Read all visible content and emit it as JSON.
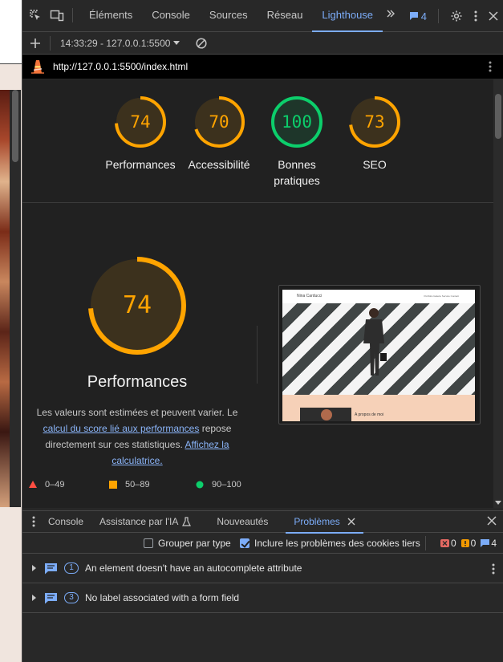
{
  "devtools": {
    "tabs": [
      "Éléments",
      "Console",
      "Sources",
      "Réseau",
      "Lighthouse"
    ],
    "active_tab": "Lighthouse",
    "issues_count": "4"
  },
  "toolbar": {
    "run_label": "14:33:29 - 127.0.0.1:5500"
  },
  "report": {
    "url": "http://127.0.0.1:5500/index.html",
    "scores": [
      {
        "label": "Performances",
        "value": 74,
        "color": "#ffa400"
      },
      {
        "label": "Accessibilité",
        "value": 70,
        "color": "#ffa400"
      },
      {
        "label": "Bonnes pratiques",
        "value": 100,
        "color": "#0cce6b"
      },
      {
        "label": "SEO",
        "value": 73,
        "color": "#ffa400"
      }
    ],
    "main_category": {
      "title": "Performances",
      "value": 74,
      "desc_part1": "Les valeurs sont estimées et peuvent varier. Le",
      "desc_link1": "calcul du score lié aux performances",
      "desc_part2": "repose directement sur ces statistiques.",
      "desc_link2": "Affichez la calculatrice."
    },
    "legend": [
      {
        "range": "0–49",
        "color": "#ff4e42"
      },
      {
        "range": "50–89",
        "color": "#ffa400"
      },
      {
        "range": "90–100",
        "color": "#0cce6b"
      }
    ],
    "screenshot": {
      "brand": "Nina Carducci",
      "nav": "Portfolio   Galerie   Service   Contact",
      "section": "A propos de moi"
    }
  },
  "drawer": {
    "tabs": [
      "Console",
      "Assistance par l'IA",
      "Nouveautés",
      "Problèmes"
    ],
    "active_tab": "Problèmes",
    "group_by_type": "Grouper par type",
    "include_cookies": "Inclure les problèmes des cookies tiers",
    "counts": {
      "errors": "0",
      "warnings": "0",
      "info": "4"
    },
    "issues": [
      {
        "count": "1",
        "text": "An element doesn't have an autocomplete attribute"
      },
      {
        "count": "3",
        "text": "No label associated with a form field"
      }
    ]
  }
}
